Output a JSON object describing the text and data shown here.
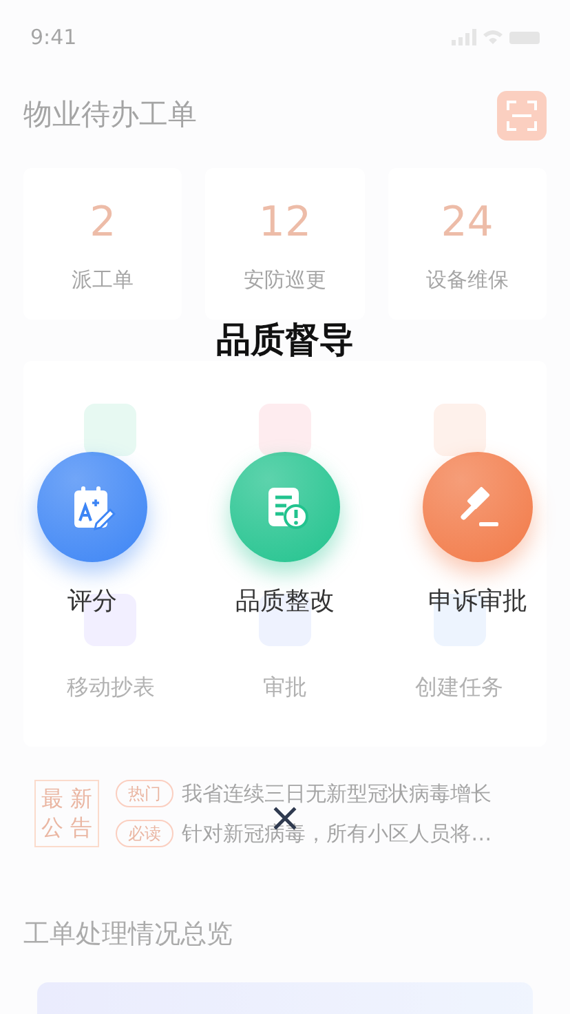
{
  "status_bar": {
    "time": "9:41"
  },
  "header": {
    "title": "物业待办工单"
  },
  "stats": [
    {
      "value": "2",
      "label": "派工单"
    },
    {
      "value": "12",
      "label": "安防巡更"
    },
    {
      "value": "24",
      "label": "设备维保"
    }
  ],
  "shortcuts": [
    {
      "kind": "shield"
    },
    {
      "kind": "chart"
    },
    {
      "kind": "text"
    },
    {
      "kind": "meter",
      "label": "移动抄表"
    },
    {
      "kind": "approve",
      "label": "审批"
    },
    {
      "kind": "task",
      "label": "创建任务"
    }
  ],
  "notice": {
    "badge_lines": [
      "最 新",
      "公 告"
    ],
    "items": [
      {
        "tag": "热门",
        "text": "我省连续三日无新型冠状病毒增长"
      },
      {
        "tag": "必读",
        "text": "针对新冠病毒，所有小区人员将…"
      }
    ]
  },
  "overview": {
    "title": "工单处理情况总览"
  },
  "modal": {
    "title": "品质督导",
    "actions": [
      {
        "kind": "grade",
        "label": "评分",
        "color": "#3d85f5"
      },
      {
        "kind": "rectify",
        "label": "品质整改",
        "color": "#22c38e"
      },
      {
        "kind": "appeal",
        "label": "申诉审批",
        "color": "#f27a48"
      }
    ]
  }
}
